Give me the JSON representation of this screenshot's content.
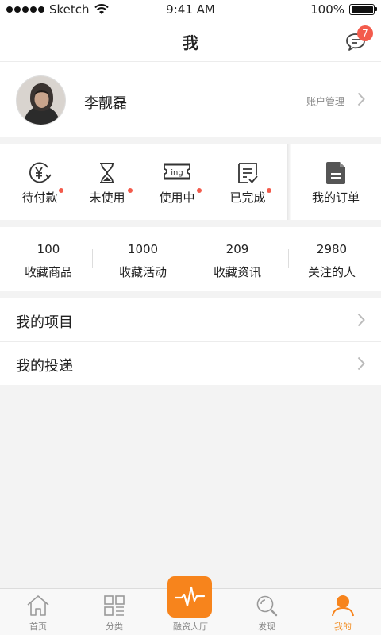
{
  "status_bar": {
    "carrier": "Sketch",
    "time": "9:41 AM",
    "battery": "100%"
  },
  "nav": {
    "title": "我",
    "message_count": "7"
  },
  "profile": {
    "name": "李靓磊",
    "account_link": "账户管理"
  },
  "orders": {
    "items": [
      {
        "label": "待付款",
        "icon": "yen-icon",
        "has_dot": true
      },
      {
        "label": "未使用",
        "icon": "hourglass-icon",
        "has_dot": true
      },
      {
        "label": "使用中",
        "icon": "ticket-icon",
        "icon_text": "ing",
        "has_dot": true
      },
      {
        "label": "已完成",
        "icon": "check-list-icon",
        "has_dot": true
      }
    ],
    "all_orders_label": "我的订单"
  },
  "stats": [
    {
      "value": "100",
      "label": "收藏商品"
    },
    {
      "value": "1000",
      "label": "收藏活动"
    },
    {
      "value": "209",
      "label": "收藏资讯"
    },
    {
      "value": "2980",
      "label": "关注的人"
    }
  ],
  "menu": [
    {
      "label": "我的项目"
    },
    {
      "label": "我的投递"
    }
  ],
  "tabs": [
    {
      "label": "首页",
      "icon": "home-icon"
    },
    {
      "label": "分类",
      "icon": "grid-icon"
    },
    {
      "label": "融资大厅",
      "icon": "pulse-icon"
    },
    {
      "label": "发现",
      "icon": "search-icon"
    },
    {
      "label": "我的",
      "icon": "user-icon",
      "active": true
    }
  ],
  "colors": {
    "accent": "#f7841c",
    "badge": "#f35b4c",
    "text": "#222222",
    "muted": "#888888",
    "background": "#f3f3f3"
  }
}
